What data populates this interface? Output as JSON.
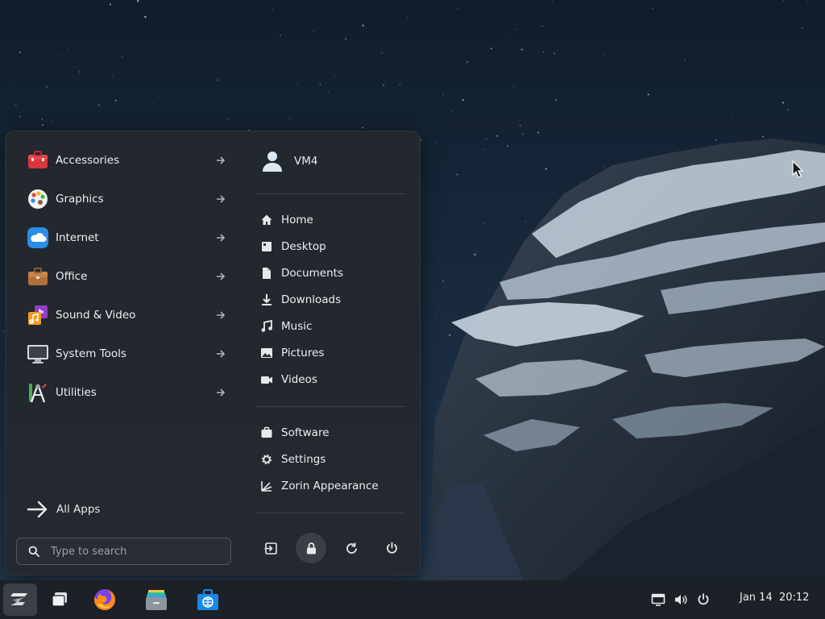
{
  "desktop": {
    "colors": {
      "sky_top": "#132233",
      "sky_bottom": "#1e3246",
      "snow": "#c9d6e2",
      "rock": "#2a3644"
    }
  },
  "menu": {
    "categories": [
      {
        "label": "Accessories",
        "icon": "toolbox-icon"
      },
      {
        "label": "Graphics",
        "icon": "palette-icon"
      },
      {
        "label": "Internet",
        "icon": "cloud-icon"
      },
      {
        "label": "Office",
        "icon": "briefcase-icon"
      },
      {
        "label": "Sound & Video",
        "icon": "music-video-icon"
      },
      {
        "label": "System Tools",
        "icon": "monitor-icon"
      },
      {
        "label": "Utilities",
        "icon": "utilities-icon"
      }
    ],
    "all_apps_label": "All Apps",
    "search": {
      "placeholder": "Type to search",
      "value": ""
    },
    "user": {
      "name": "VM4"
    },
    "places": [
      {
        "label": "Home",
        "icon": "home-icon"
      },
      {
        "label": "Desktop",
        "icon": "desktop-folder-icon"
      },
      {
        "label": "Documents",
        "icon": "document-icon"
      },
      {
        "label": "Downloads",
        "icon": "download-icon"
      },
      {
        "label": "Music",
        "icon": "music-note-icon"
      },
      {
        "label": "Pictures",
        "icon": "picture-icon"
      },
      {
        "label": "Videos",
        "icon": "video-camera-icon"
      }
    ],
    "system": [
      {
        "label": "Software",
        "icon": "software-bag-icon"
      },
      {
        "label": "Settings",
        "icon": "gear-icon"
      },
      {
        "label": "Zorin Appearance",
        "icon": "appearance-icon"
      }
    ],
    "power_buttons": [
      "logout-icon",
      "lock-icon",
      "restart-icon",
      "power-icon"
    ],
    "active_power_button": "lock-icon"
  },
  "taskbar": {
    "apps": [
      "zorin-menu-icon",
      "workspaces-icon",
      "firefox-icon",
      "files-icon",
      "software-store-icon"
    ],
    "tray": [
      "network-icon",
      "volume-icon",
      "power-icon"
    ],
    "clock": {
      "date": "Jan 14",
      "time": "20:12"
    },
    "accent": "#15a6f0"
  }
}
